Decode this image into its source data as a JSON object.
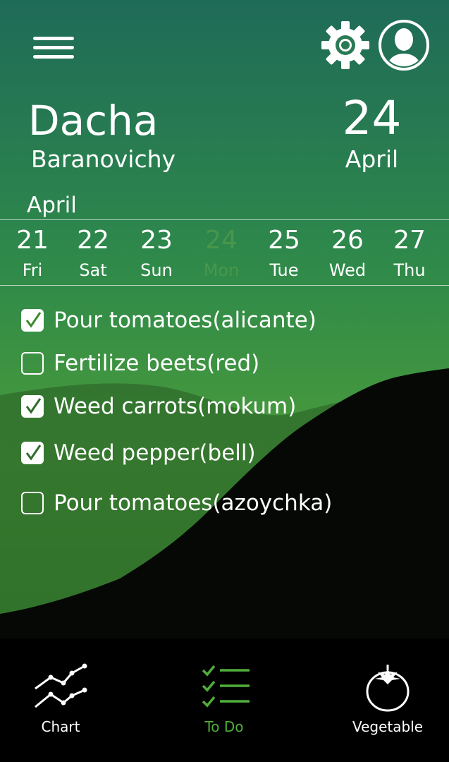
{
  "header": {
    "menu_icon": "hamburger-menu-icon",
    "settings_icon": "gear-icon",
    "profile_icon": "user-avatar-icon"
  },
  "location": {
    "name": "Dacha",
    "city": "Baranovichy"
  },
  "current_date": {
    "day": "24",
    "month": "April"
  },
  "calendar": {
    "month": "April",
    "days": [
      {
        "num": "21",
        "name": "Fri"
      },
      {
        "num": "22",
        "name": "Sat"
      },
      {
        "num": "23",
        "name": "Sun"
      },
      {
        "num": "24",
        "name": "Mon"
      },
      {
        "num": "25",
        "name": "Tue"
      },
      {
        "num": "26",
        "name": "Wed"
      },
      {
        "num": "27",
        "name": "Thu"
      }
    ],
    "selected_index": 3
  },
  "tasks": [
    {
      "label": "Pour tomatoes(alicante)",
      "checked": true
    },
    {
      "label": "Fertilize beets(red)",
      "checked": false
    },
    {
      "label": "Weed carrots(mokum)",
      "checked": true
    },
    {
      "label": "Weed pepper(bell)",
      "checked": true
    },
    {
      "label": "Pour tomatoes(azoychka)",
      "checked": false
    }
  ],
  "nav": {
    "items": [
      {
        "label": "Chart",
        "icon": "line-chart-icon"
      },
      {
        "label": "To Do",
        "icon": "checklist-icon"
      },
      {
        "label": "Vegetable",
        "icon": "tomato-icon"
      }
    ],
    "active_index": 1
  },
  "colors": {
    "accent": "#4fae3a",
    "sky_top": "#1f6b58",
    "sky_bottom": "#3b8a2c",
    "selected_day": "#4f9b4c"
  }
}
